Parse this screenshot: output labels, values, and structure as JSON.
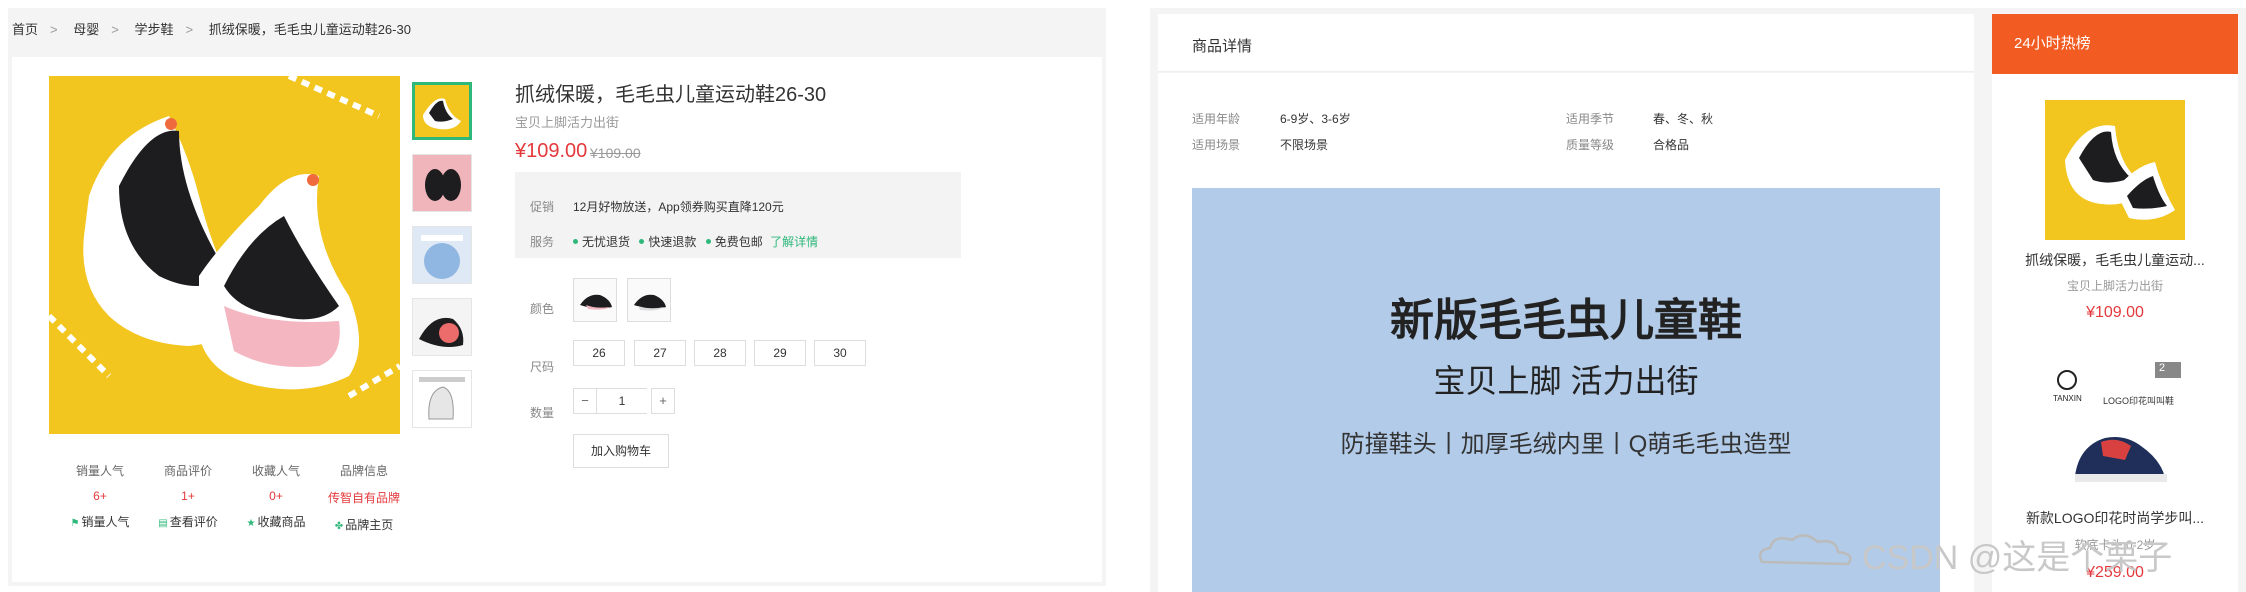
{
  "breadcrumb": [
    "首页",
    "母婴",
    "学步鞋",
    "抓绒保暖，毛毛虫儿童运动鞋26-30"
  ],
  "breadcrumb_separator": ">",
  "product": {
    "title": "抓绒保暖，毛毛虫儿童运动鞋26-30",
    "subtitle": "宝贝上脚活力出街",
    "price": "¥109.00",
    "old_price": "¥109.00"
  },
  "promo": {
    "promo_label": "促销",
    "promo_text": "12月好物放送，App领券购买直降120元",
    "service_label": "服务",
    "services": [
      "无忧退货",
      "快速退款",
      "免费包邮"
    ],
    "detail_link": "了解详情"
  },
  "options": {
    "color_label": "颜色",
    "size_label": "尺码",
    "sizes": [
      "26",
      "27",
      "28",
      "29",
      "30"
    ],
    "qty_label": "数量",
    "qty_minus": "−",
    "qty_value": "1",
    "qty_plus": "+",
    "add_to_cart": "加入购物车"
  },
  "stats": [
    {
      "title": "销量人气",
      "value": "6+",
      "action": "销量人气",
      "icon": "flag-icon"
    },
    {
      "title": "商品评价",
      "value": "1+",
      "action": "查看评价",
      "icon": "comment-icon"
    },
    {
      "title": "收藏人气",
      "value": "0+",
      "action": "收藏商品",
      "icon": "star-icon"
    },
    {
      "title": "品牌信息",
      "value": "传智自有品牌",
      "action": "品牌主页",
      "icon": "brand-icon"
    }
  ],
  "detail": {
    "header": "商品详情",
    "attrs": [
      {
        "label": "适用年龄",
        "value": "6-9岁、3-6岁"
      },
      {
        "label": "适用季节",
        "value": "春、冬、秋"
      },
      {
        "label": "适用场景",
        "value": "不限场景"
      },
      {
        "label": "质量等级",
        "value": "合格品"
      }
    ],
    "banner": {
      "title": "新版毛毛虫儿童鞋",
      "line2": "宝贝上脚 活力出街",
      "line3": "防撞鞋头丨加厚毛绒内里丨Q萌毛毛虫造型"
    }
  },
  "hot": {
    "header": "24小时热榜",
    "items": [
      {
        "title": "抓绒保暖，毛毛虫儿童运动...",
        "sub": "宝贝上脚活力出街",
        "price": "¥109.00"
      },
      {
        "title": "新款LOGO印花时尚学步叫...",
        "sub": "软底卡头 0-2岁",
        "price": "¥259.00"
      }
    ],
    "item2_badge": "2",
    "item2_brand": "TANXIN",
    "item2_img_text": "LOGO印花叫叫鞋"
  },
  "watermark": "CSDN @这是个栗子",
  "colors": {
    "accent": "#e4393c",
    "green": "#2eb87a",
    "hot": "#f25b22",
    "banner": "#b2cbe8"
  }
}
